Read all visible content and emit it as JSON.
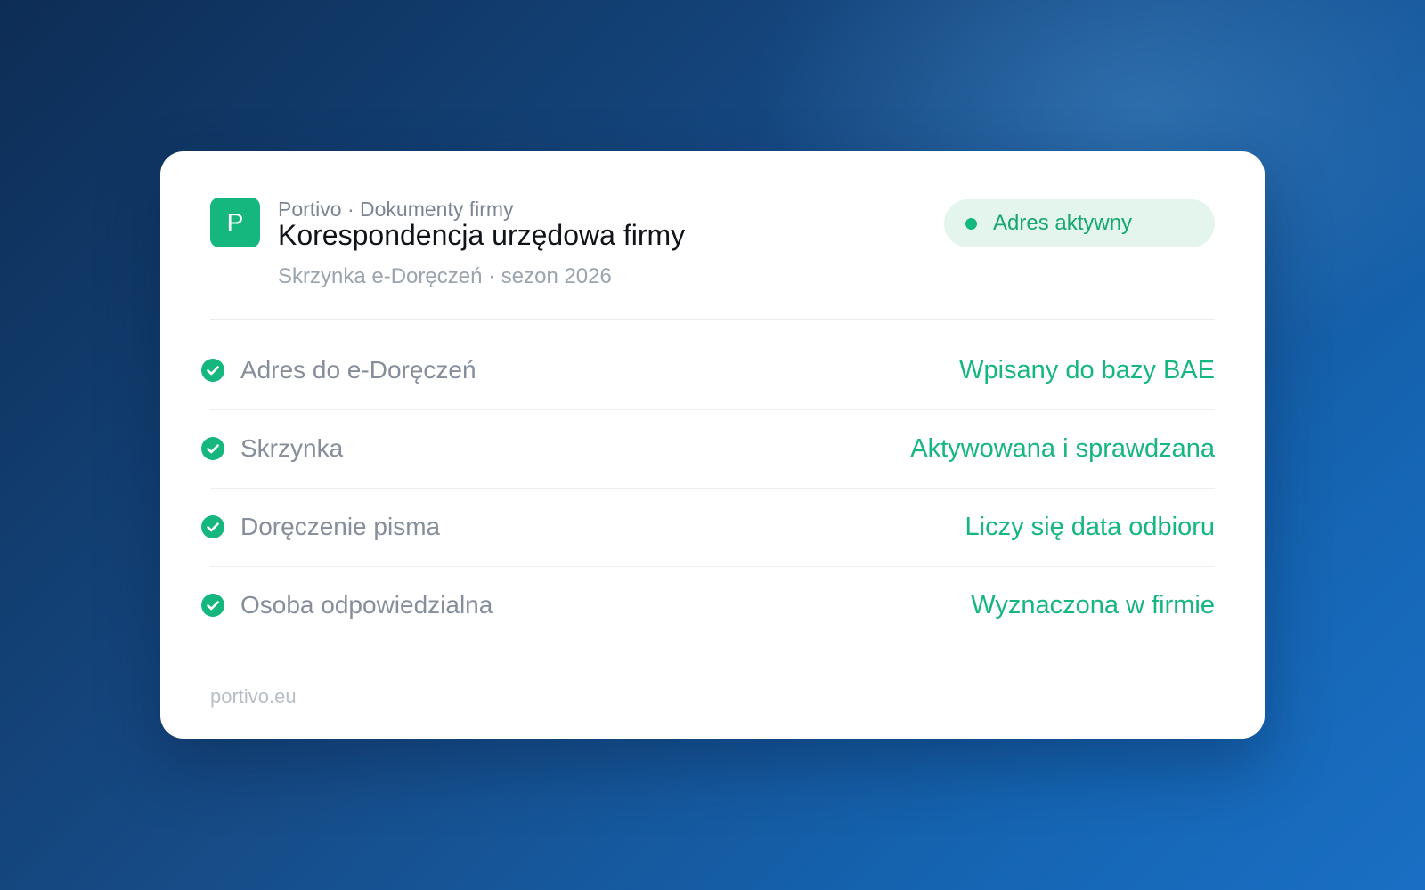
{
  "card": {
    "logo_letter": "P",
    "eyebrow": "Portivo · Dokumenty firmy",
    "title": "Korespondencja urzędowa firmy",
    "subtitle": "Skrzynka e-Doręczeń · sezon 2026",
    "status": {
      "label": "Adres aktywny",
      "color": "#16b67f"
    },
    "rows": [
      {
        "label": "Adres do e-Doręczeń",
        "value": "Wpisany do bazy BAE",
        "icon": "check-circle-icon"
      },
      {
        "label": "Skrzynka",
        "value": "Aktywowana i sprawdzana",
        "icon": "check-circle-icon"
      },
      {
        "label": "Doręczenie pisma",
        "value": "Liczy się data odbioru",
        "icon": "check-circle-icon"
      },
      {
        "label": "Osoba odpowiedzialna",
        "value": "Wyznaczona w firmie",
        "icon": "check-circle-icon"
      }
    ],
    "footer": "portivo.eu"
  },
  "colors": {
    "accent": "#16b67f",
    "background_dark": "#0d2d55",
    "background_light": "#1a6fc4"
  }
}
